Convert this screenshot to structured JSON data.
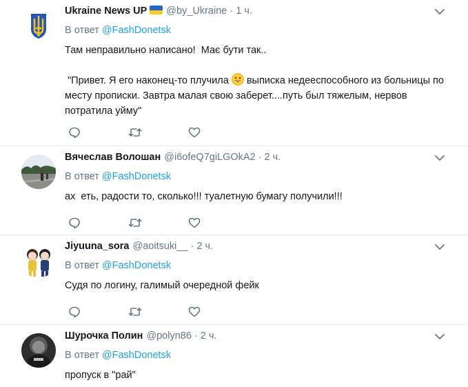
{
  "tweets": [
    {
      "author_name": "Ukraine News UP",
      "handle": "@by_Ukraine",
      "dot": "·",
      "time": "1 ч.",
      "reply_prefix": "В ответ",
      "reply_mention": "@FashDonetsk",
      "text_line1": "Там неправильно написано!  Має бути так..",
      "text_quote_part1": " \"Привет. Я его наконец-то плучила ",
      "text_quote_part2": " выписка недееспособного из больницы по месту прописки. Завтра малая свою заберет....путь был тяжелым, нервов потратила уйму\""
    },
    {
      "author_name": "Вячеслав Волошан",
      "handle": "@i6ofeQ7giLGOkA2",
      "dot": "·",
      "time": "2 ч.",
      "reply_prefix": "В ответ",
      "reply_mention": "@FashDonetsk",
      "text": "ах  еть, радости то, сколько!!! туалетную бумагу получили!!!"
    },
    {
      "author_name": "Jiyuuna_sora",
      "handle": "@aoitsuki__",
      "dot": "·",
      "time": "2 ч.",
      "reply_prefix": "В ответ",
      "reply_mention": "@FashDonetsk",
      "text": "Судя по логину, галимый очередной фейк"
    },
    {
      "author_name": "Шурочка Полин",
      "handle": "@polyn86",
      "dot": "·",
      "time": "2 ч.",
      "reply_prefix": "В ответ",
      "reply_mention": "@FashDonetsk",
      "text": "пропуск в \"рай\""
    }
  ],
  "icons": {
    "reply": "reply-icon",
    "retweet": "retweet-icon",
    "like": "heart-icon",
    "more": "chevron-down-icon",
    "flag": "ukraine-flag-icon",
    "emoji": "grinning-face-emoji"
  },
  "colors": {
    "text": "#14171a",
    "muted": "#657786",
    "link": "#1da1f2",
    "divider": "#e6ecf0",
    "flag_blue": "#2a66c9",
    "flag_yellow": "#f5cc1f"
  }
}
